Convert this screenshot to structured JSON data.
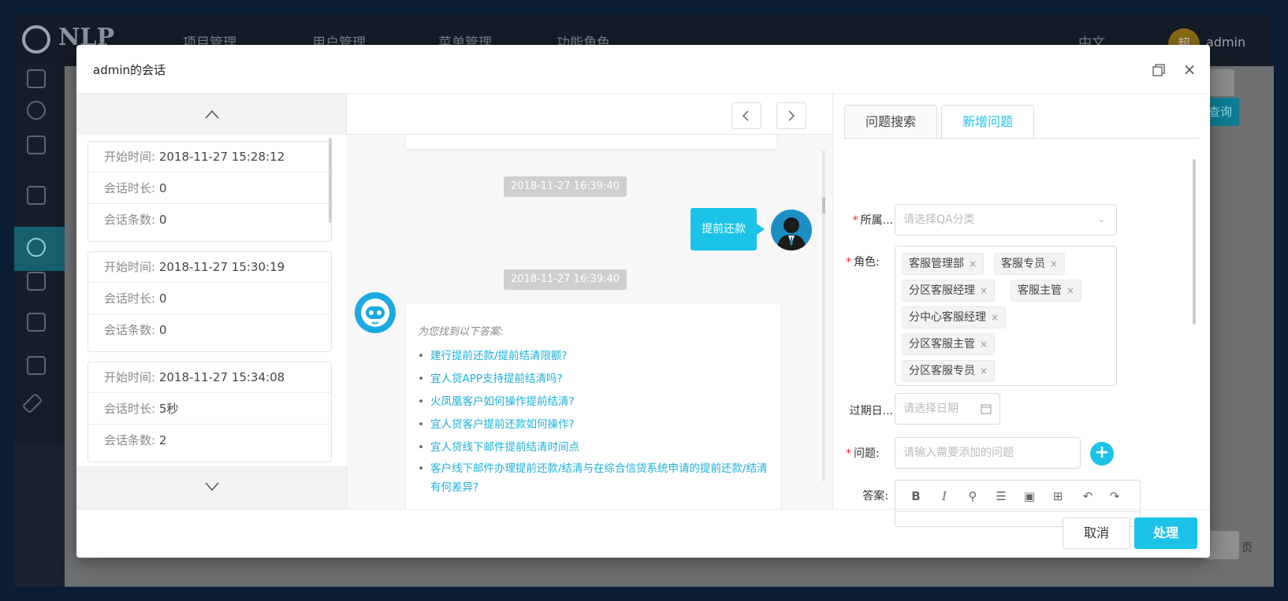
{
  "background": {
    "logo_text": "NLP",
    "nav": [
      "项目管理",
      "用户管理",
      "菜单管理",
      "功能角色"
    ],
    "lang": "中文",
    "avatar_letter": "超",
    "username": "admin",
    "query_label": "查询",
    "page_suffix": "页"
  },
  "modal": {
    "title": "admin的会话",
    "sessions": [
      {
        "start_label": "开始时间:",
        "start": "2018-11-27 15:28:12",
        "duration_label": "会话时长:",
        "duration": "0",
        "count_label": "会话条数:",
        "count": "0"
      },
      {
        "start_label": "开始时间:",
        "start": "2018-11-27 15:30:19",
        "duration_label": "会话时长:",
        "duration": "0",
        "count_label": "会话条数:",
        "count": "0"
      },
      {
        "start_label": "开始时间:",
        "start": "2018-11-27 15:34:08",
        "duration_label": "会话时长:",
        "duration": "5秒",
        "count_label": "会话条数:",
        "count": "2"
      }
    ],
    "chat": {
      "timestamp_1": "2018-11-27 16:39:40",
      "user_message": "提前还款",
      "timestamp_2": "2018-11-27 16:39:40",
      "answer_intro": "为您找到以下答案:",
      "answers": [
        "建行提前还款/提前结清限额?",
        "宜人贷APP支持提前结清吗?",
        "火凤凰客户如何操作提前结清?",
        "宜人贷客户提前还款如何操作?",
        "宜人贷线下邮件提前结清时间点",
        "客户线下邮件办理提前还款/结清与在综合信贷系统申请的提前还款/结清有何差异?"
      ]
    },
    "form": {
      "tab_search": "问题搜索",
      "tab_new": "新增问题",
      "category_label": "所属...",
      "category_placeholder": "请选择QA分类",
      "role_label": "角色:",
      "roles": [
        "客服管理部",
        "客服专员",
        "分区客服经理",
        "客服主管",
        "分中心客服经理",
        "分区客服主管",
        "分区客服专员"
      ],
      "expire_label": "过期日...",
      "expire_placeholder": "请选择日期",
      "question_label": "问题:",
      "question_placeholder": "请输入需要添加的问题",
      "answer_label": "答案:",
      "toolbar": [
        "B",
        "I",
        "link",
        "list",
        "image",
        "table",
        "undo",
        "redo"
      ]
    },
    "cancel_label": "取消",
    "ok_label": "处理"
  },
  "colors": {
    "accent": "#1cc3e8",
    "required": "#f5222d"
  }
}
